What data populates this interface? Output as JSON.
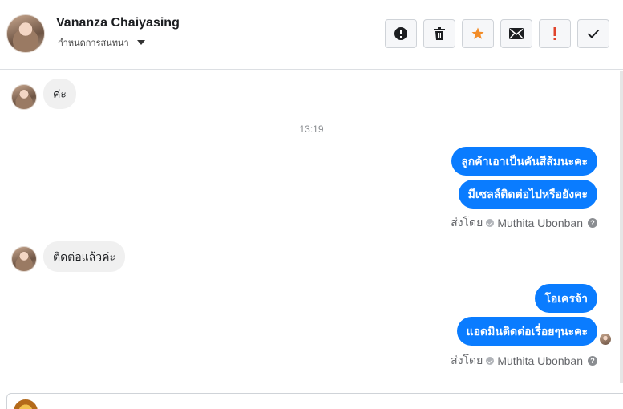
{
  "header": {
    "name": "Vananza Chaiyasing",
    "subtitle": "กำหนดการสนทนา",
    "tools": [
      {
        "icon": "exclamation-circle-icon",
        "color": "#1c1e21"
      },
      {
        "icon": "trash-icon",
        "color": "#1c1e21"
      },
      {
        "icon": "star-icon",
        "color": "#f28c28"
      },
      {
        "icon": "envelope-icon",
        "color": "#1c1e21"
      },
      {
        "icon": "exclamation-icon",
        "color": "#e0442c"
      },
      {
        "icon": "check-icon",
        "color": "#1c1e21"
      }
    ]
  },
  "messages": {
    "in_1": "ค่ะ",
    "time_1": "13:19",
    "out_1": "ลูกค้าเอาเป็นคันสีส้มนะคะ",
    "out_2": "มีเซลล์ติดต่อไปหรือยังคะ",
    "sent_by_prefix_1": "ส่งโดย",
    "sent_by_name_1": "Muthita Ubonban",
    "in_2": "ติดต่อแล้วค่ะ",
    "out_3": "โอเครจ้า",
    "out_4": "แอดมินติดต่อเรื่อยๆนะคะ",
    "sent_by_prefix_2": "ส่งโดย",
    "sent_by_name_2": "Muthita Ubonban"
  },
  "composer": {
    "placeholder": ""
  },
  "colors": {
    "accent": "#0a7cff",
    "incoming_bubble": "#f0f0f0"
  }
}
